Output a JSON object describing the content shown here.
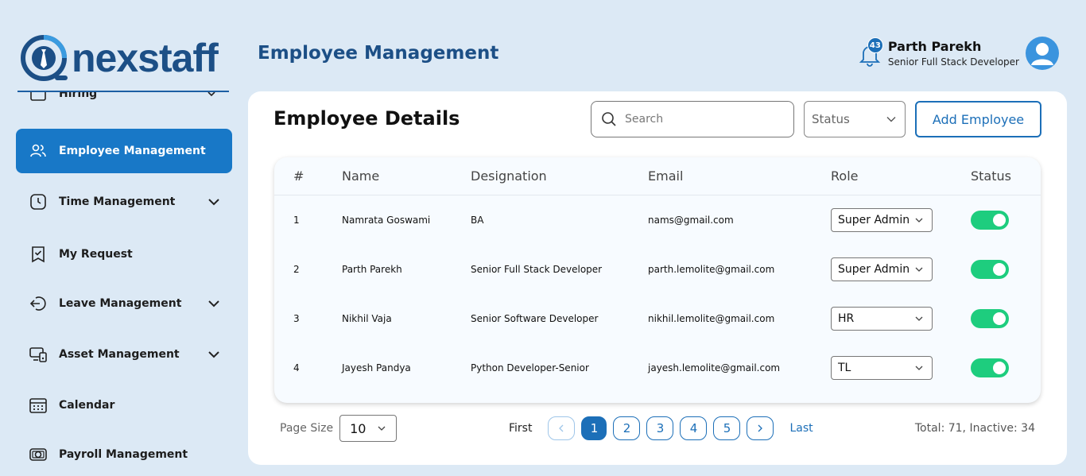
{
  "brand": {
    "name": "nexstaff",
    "color": "#1c4f86"
  },
  "header": {
    "title": "Employee Management"
  },
  "user": {
    "name": "Parth Parekh",
    "role": "Senior Full Stack Developer",
    "notifications": "43"
  },
  "sidebar": {
    "items": [
      {
        "label": "Hiring",
        "icon": "briefcase-icon",
        "expandable": true
      },
      {
        "label": "Employee Management",
        "icon": "users-icon",
        "active": true
      },
      {
        "label": "Time Management",
        "icon": "clock-icon",
        "expandable": true
      },
      {
        "label": "My Request",
        "icon": "request-icon"
      },
      {
        "label": "Leave Management",
        "icon": "leave-icon",
        "expandable": true
      },
      {
        "label": "Asset Management",
        "icon": "asset-icon",
        "expandable": true
      },
      {
        "label": "Calendar",
        "icon": "calendar-icon"
      },
      {
        "label": "Payroll Management",
        "icon": "payroll-icon"
      }
    ]
  },
  "card": {
    "title": "Employee Details",
    "search_placeholder": "Search",
    "status_filter": "Status",
    "add_button": "Add Employee"
  },
  "table": {
    "headers": {
      "num": "#",
      "name": "Name",
      "designation": "Designation",
      "email": "Email",
      "role": "Role",
      "status": "Status"
    },
    "rows": [
      {
        "num": "1",
        "name": "Namrata Goswami",
        "designation": "BA",
        "email": "nams@gmail.com",
        "role": "Super Admin",
        "active": true
      },
      {
        "num": "2",
        "name": "Parth Parekh",
        "designation": "Senior Full Stack Developer",
        "email": "parth.lemolite@gmail.com",
        "role": "Super Admin",
        "active": true
      },
      {
        "num": "3",
        "name": "Nikhil Vaja",
        "designation": "Senior Software Developer",
        "email": "nikhil.lemolite@gmail.com",
        "role": "HR",
        "active": true
      },
      {
        "num": "4",
        "name": "Jayesh Pandya",
        "designation": "Python Developer-Senior",
        "email": "jayesh.lemolite@gmail.com",
        "role": "TL",
        "active": true
      }
    ]
  },
  "pagination": {
    "page_size_label": "Page Size",
    "page_size": "10",
    "first": "First",
    "last": "Last",
    "pages": [
      "1",
      "2",
      "3",
      "4",
      "5"
    ],
    "current": "1",
    "totals": "Total: 71, Inactive: 34"
  },
  "colors": {
    "accent": "#1878c7",
    "toggle_on": "#1ecd7e",
    "background": "#dce9f5"
  }
}
